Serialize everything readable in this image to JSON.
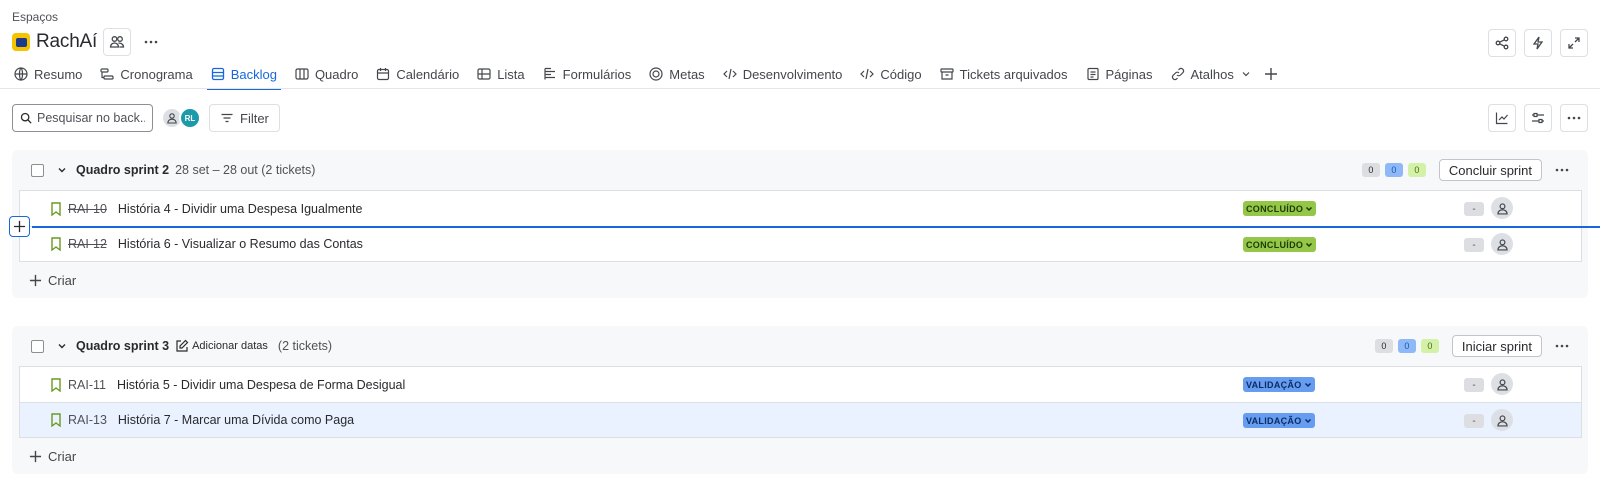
{
  "breadcrumb": "Espaços",
  "project": {
    "name": "RachAí"
  },
  "tabs": [
    {
      "label": "Resumo",
      "icon": "globe-icon"
    },
    {
      "label": "Cronograma",
      "icon": "timeline-icon"
    },
    {
      "label": "Backlog",
      "icon": "backlog-icon",
      "active": true
    },
    {
      "label": "Quadro",
      "icon": "board-icon"
    },
    {
      "label": "Calendário",
      "icon": "calendar-icon"
    },
    {
      "label": "Lista",
      "icon": "list-icon"
    },
    {
      "label": "Formulários",
      "icon": "forms-icon"
    },
    {
      "label": "Metas",
      "icon": "goals-icon"
    },
    {
      "label": "Desenvolvimento",
      "icon": "code-icon"
    },
    {
      "label": "Código",
      "icon": "code-icon"
    },
    {
      "label": "Tickets arquivados",
      "icon": "archive-icon"
    },
    {
      "label": "Páginas",
      "icon": "pages-icon"
    },
    {
      "label": "Atalhos",
      "icon": "link-icon"
    }
  ],
  "toolbar": {
    "search_placeholder": "Pesquisar no back...",
    "avatar_initials": "RL",
    "filter_label": "Filter"
  },
  "sprints": [
    {
      "name": "Quadro sprint 2",
      "dates": "28 set – 28 out (2 tickets)",
      "counts": {
        "todo": "0",
        "in_progress": "0",
        "done": "0"
      },
      "action": "Concluir sprint",
      "items": [
        {
          "key": "RAI-10",
          "summary": "História 4 - Dividir uma Despesa Igualmente",
          "status": "CONCLUÍDO",
          "estimate": "-"
        },
        {
          "key": "RAI-12",
          "summary": "História 6 - Visualizar o Resumo das Contas",
          "status": "CONCLUÍDO",
          "estimate": "-"
        }
      ],
      "create_label": "Criar"
    },
    {
      "name": "Quadro sprint 3",
      "add_dates": "Adicionar datas",
      "dates": "(2 tickets)",
      "counts": {
        "todo": "0",
        "in_progress": "0",
        "done": "0"
      },
      "action": "Iniciar sprint",
      "items": [
        {
          "key": "RAI-11",
          "summary": "História 5 - Dividir uma Despesa de Forma Desigual",
          "status": "VALIDAÇÃO",
          "estimate": "-"
        },
        {
          "key": "RAI-13",
          "summary": "História 7 - Marcar uma Dívida como Paga",
          "status": "VALIDAÇÃO",
          "estimate": "-"
        }
      ],
      "create_label": "Criar"
    }
  ],
  "colors": {
    "accent": "#1868db",
    "done_lozenge": "#94c748",
    "validation_lozenge": "#669df1"
  }
}
